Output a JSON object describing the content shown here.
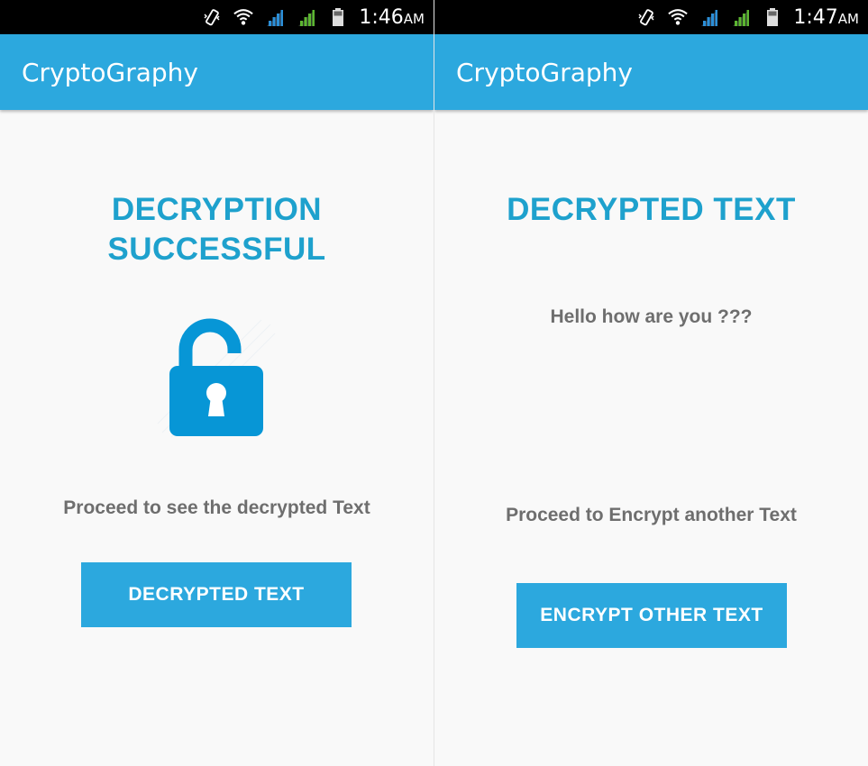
{
  "left_screen": {
    "status_bar": {
      "time": "1:46",
      "ampm": "AM",
      "icons": [
        "vibrate-icon",
        "wifi-icon",
        "signal-sim1-icon",
        "signal-sim2-icon",
        "battery-icon"
      ]
    },
    "app_bar": {
      "title": "CryptoGraphy"
    },
    "heading_line1": "DECRYPTION",
    "heading_line2": "SUCCESSFUL",
    "image": {
      "icon": "unlocked-padlock-icon",
      "color": "#0796d6"
    },
    "message": "Proceed to see the decrypted Text",
    "button_label": "DECRYPTED TEXT"
  },
  "right_screen": {
    "status_bar": {
      "time": "1:47",
      "ampm": "AM",
      "icons": [
        "vibrate-icon",
        "wifi-icon",
        "signal-sim1-icon",
        "signal-sim2-icon",
        "battery-icon"
      ]
    },
    "app_bar": {
      "title": "CryptoGraphy"
    },
    "heading": "DECRYPTED TEXT",
    "decrypted_text": "Hello how are you ???",
    "message": "Proceed to Encrypt another Text",
    "button_label": "ENCRYPT OTHER TEXT"
  },
  "colors": {
    "primary": "#2ca8de",
    "heading": "#1ea1cd",
    "body_text": "#6e6e6e",
    "status_bar": "#000000",
    "signal_sim1": "#2b8fd8",
    "signal_sim2": "#5cb531",
    "background": "#f9f9f9"
  }
}
